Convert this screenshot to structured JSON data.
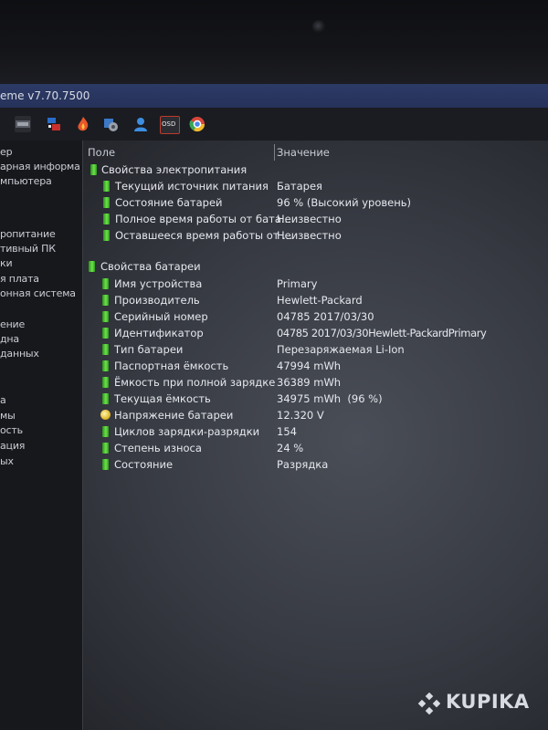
{
  "window": {
    "title": "eme v7.70.7500"
  },
  "toolbar": {
    "icons": [
      "monitor-icon",
      "network-icon",
      "flame-icon",
      "hardware-icon",
      "user-icon",
      "osd-icon",
      "chrome-icon"
    ],
    "osd_label": "OSD"
  },
  "sidebar": {
    "items": [
      "ер",
      "арная информа",
      "мпьютера",
      "",
      "",
      "ропитание",
      "тивный ПК",
      "ки",
      "я плата",
      "онная система",
      "",
      "ение",
      "дна",
      "данных",
      "",
      "а",
      "мы",
      "ость",
      "ация",
      "ых"
    ]
  },
  "table": {
    "columns": [
      "Поле",
      "Значение"
    ],
    "sections": [
      {
        "title": "Свойства электропитания",
        "rows": [
          {
            "field": "Текущий источник питания",
            "value": "Батарея"
          },
          {
            "field": "Состояние батарей",
            "value": "96 % (Высокий уровень)"
          },
          {
            "field": "Полное время работы от бата...",
            "value": "Неизвестно"
          },
          {
            "field": "Оставшееся время работы от ...",
            "value": "Неизвестно"
          }
        ]
      },
      {
        "title": "Свойства батареи",
        "rows": [
          {
            "field": "Имя устройства",
            "value": "Primary"
          },
          {
            "field": "Производитель",
            "value": "Hewlett-Packard"
          },
          {
            "field": "Серийный номер",
            "value": "04785 2017/03/30"
          },
          {
            "field": "Идентификатор",
            "value": "04785 2017/03/30Hewlett-PackardPrimary"
          },
          {
            "field": "Тип батареи",
            "value": "Перезаряжаемая Li-Ion"
          },
          {
            "field": "Паспортная ёмкость",
            "value": "47994 mWh"
          },
          {
            "field": "Ёмкость при полной зарядке",
            "value": "36389 mWh"
          },
          {
            "field": "Текущая ёмкость",
            "value": "34975 mWh  (96 %)"
          },
          {
            "field": "Напряжение батареи",
            "value": "12.320 V"
          },
          {
            "field": "Циклов зарядки-разрядки",
            "value": "154"
          },
          {
            "field": "Степень износа",
            "value": "24 %"
          },
          {
            "field": "Состояние",
            "value": "Разрядка"
          }
        ]
      }
    ]
  },
  "watermark": {
    "text": "KUPIKA"
  }
}
